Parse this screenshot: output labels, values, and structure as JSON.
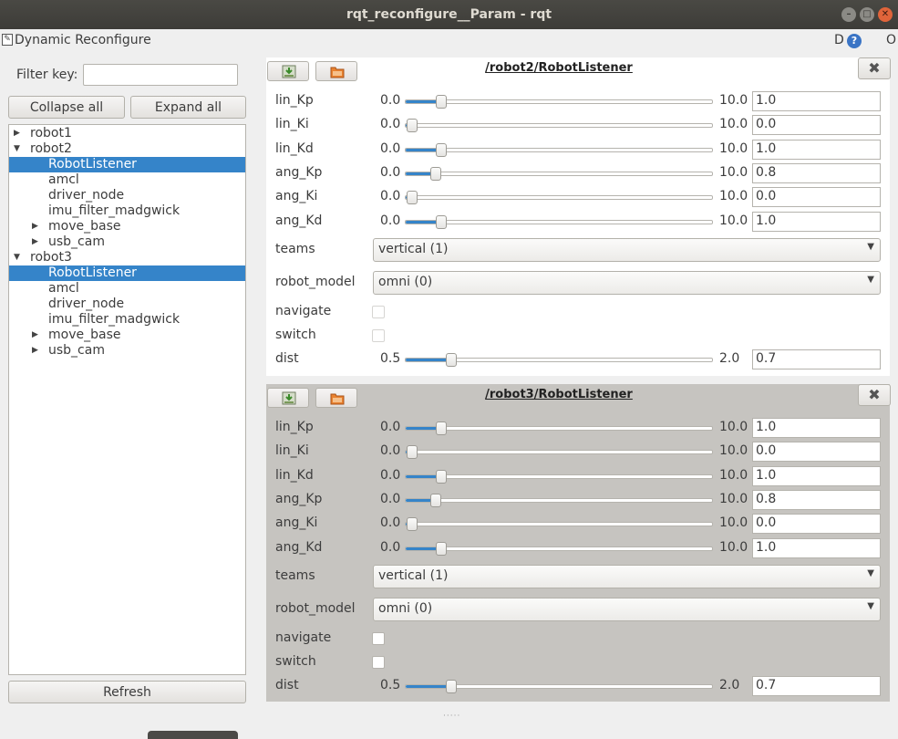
{
  "window": {
    "title": "rqt_reconfigure__Param - rqt",
    "min": "–",
    "max": "□",
    "close": "✕"
  },
  "plugin": {
    "title": "Dynamic Reconfigure",
    "right_d": "D",
    "right_help": "?",
    "right_o": "O"
  },
  "left": {
    "filter_label": "Filter key:",
    "filter_value": "",
    "collapse_label": "Collapse all",
    "expand_label": "Expand all",
    "refresh_label": "Refresh",
    "tree": [
      {
        "label": "robot1",
        "indent": 0,
        "arrow": "right",
        "selected": false
      },
      {
        "label": "robot2",
        "indent": 0,
        "arrow": "down",
        "selected": false
      },
      {
        "label": "RobotListener",
        "indent": 1,
        "arrow": "",
        "selected": true
      },
      {
        "label": "amcl",
        "indent": 1,
        "arrow": "",
        "selected": false
      },
      {
        "label": "driver_node",
        "indent": 1,
        "arrow": "",
        "selected": false
      },
      {
        "label": "imu_filter_madgwick",
        "indent": 1,
        "arrow": "",
        "selected": false
      },
      {
        "label": "move_base",
        "indent": 1,
        "arrow": "right",
        "selected": false
      },
      {
        "label": "usb_cam",
        "indent": 1,
        "arrow": "right",
        "selected": false
      },
      {
        "label": "robot3",
        "indent": 0,
        "arrow": "down",
        "selected": false
      },
      {
        "label": "RobotListener",
        "indent": 1,
        "arrow": "",
        "selected": true
      },
      {
        "label": "amcl",
        "indent": 1,
        "arrow": "",
        "selected": false
      },
      {
        "label": "driver_node",
        "indent": 1,
        "arrow": "",
        "selected": false
      },
      {
        "label": "imu_filter_madgwick",
        "indent": 1,
        "arrow": "",
        "selected": false
      },
      {
        "label": "move_base",
        "indent": 1,
        "arrow": "right",
        "selected": false
      },
      {
        "label": "usb_cam",
        "indent": 1,
        "arrow": "right",
        "selected": false
      }
    ]
  },
  "panels": [
    {
      "title": "/robot2/RobotListener",
      "close": "✖",
      "sliders": [
        {
          "name": "lin_Kp",
          "min": "0.0",
          "max": "10.0",
          "value": "1.0",
          "fraction": 0.1
        },
        {
          "name": "lin_Ki",
          "min": "0.0",
          "max": "10.0",
          "value": "0.0",
          "fraction": 0.0
        },
        {
          "name": "lin_Kd",
          "min": "0.0",
          "max": "10.0",
          "value": "1.0",
          "fraction": 0.1
        },
        {
          "name": "ang_Kp",
          "min": "0.0",
          "max": "10.0",
          "value": "0.8",
          "fraction": 0.08
        },
        {
          "name": "ang_Ki",
          "min": "0.0",
          "max": "10.0",
          "value": "0.0",
          "fraction": 0.0
        },
        {
          "name": "ang_Kd",
          "min": "0.0",
          "max": "10.0",
          "value": "1.0",
          "fraction": 0.1
        }
      ],
      "teams_label": "teams",
      "teams_value": "vertical (1)",
      "robot_model_label": "robot_model",
      "robot_model_value": "omni (0)",
      "navigate_label": "navigate",
      "switch_label": "switch",
      "dist": {
        "name": "dist",
        "min": "0.5",
        "max": "2.0",
        "value": "0.7",
        "fraction": 0.133
      }
    },
    {
      "title": "/robot3/RobotListener",
      "close": "✖",
      "sliders": [
        {
          "name": "lin_Kp",
          "min": "0.0",
          "max": "10.0",
          "value": "1.0",
          "fraction": 0.1
        },
        {
          "name": "lin_Ki",
          "min": "0.0",
          "max": "10.0",
          "value": "0.0",
          "fraction": 0.0
        },
        {
          "name": "lin_Kd",
          "min": "0.0",
          "max": "10.0",
          "value": "1.0",
          "fraction": 0.1
        },
        {
          "name": "ang_Kp",
          "min": "0.0",
          "max": "10.0",
          "value": "0.8",
          "fraction": 0.08
        },
        {
          "name": "ang_Ki",
          "min": "0.0",
          "max": "10.0",
          "value": "0.0",
          "fraction": 0.0
        },
        {
          "name": "ang_Kd",
          "min": "0.0",
          "max": "10.0",
          "value": "1.0",
          "fraction": 0.1
        }
      ],
      "teams_label": "teams",
      "teams_value": "vertical (1)",
      "robot_model_label": "robot_model",
      "robot_model_value": "omni (0)",
      "navigate_label": "navigate",
      "switch_label": "switch",
      "dist": {
        "name": "dist",
        "min": "0.5",
        "max": "2.0",
        "value": "0.7",
        "fraction": 0.133
      }
    }
  ]
}
